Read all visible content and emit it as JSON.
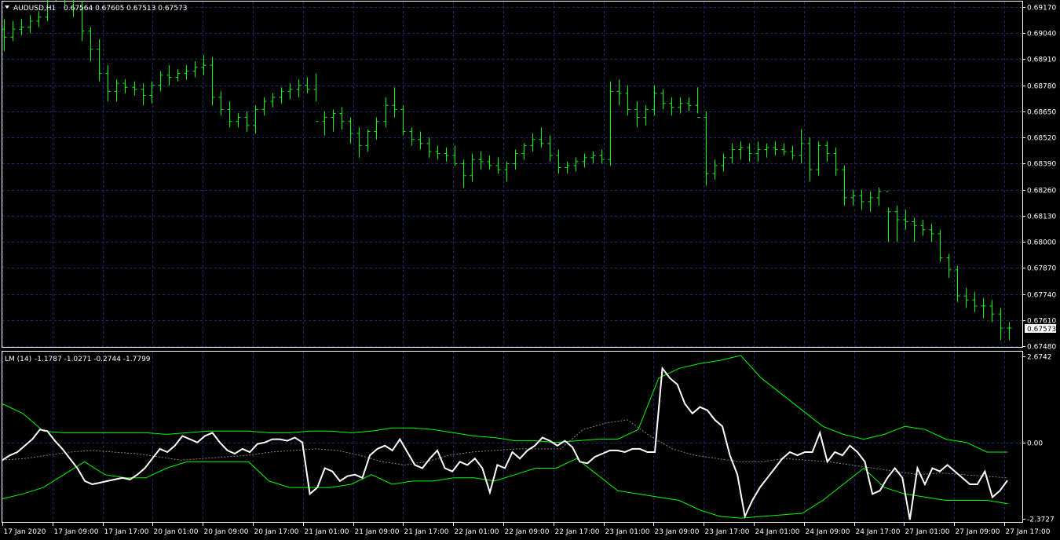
{
  "main_panel": {
    "header": {
      "symbol": "AUDUSD,H1",
      "ohlc": "0.67564 0.67605 0.67513 0.67573"
    },
    "price_axis_labels": [
      "0.69170",
      "0.69040",
      "0.68910",
      "0.68780",
      "0.68650",
      "0.68520",
      "0.68390",
      "0.68260",
      "0.68130",
      "0.68000",
      "0.67870",
      "0.67740",
      "0.67610",
      "0.67480"
    ],
    "current_price_tag": "0.67573",
    "bar_color": "#00ff00",
    "grid_color": "#1f2a6b"
  },
  "indicator_panel": {
    "header": {
      "name": "LM (14)",
      "values": "-1.1787 -1.0271 -0.2744 -1.7799"
    },
    "axis_labels": [
      "2.6742",
      "0.00",
      "-2.3727"
    ]
  },
  "time_axis_labels": [
    "17 Jan 2020",
    "17 Jan 09:00",
    "17 Jan 17:00",
    "20 Jan 01:00",
    "20 Jan 09:00",
    "20 Jan 17:00",
    "21 Jan 01:00",
    "21 Jan 09:00",
    "21 Jan 17:00",
    "22 Jan 01:00",
    "22 Jan 09:00",
    "22 Jan 17:00",
    "23 Jan 01:00",
    "23 Jan 09:00",
    "23 Jan 17:00",
    "24 Jan 01:00",
    "24 Jan 09:00",
    "24 Jan 17:00",
    "27 Jan 01:00",
    "27 Jan 09:00",
    "27 Jan 17:00"
  ],
  "chart_data": {
    "type": "line",
    "title": "AUDUSD,H1",
    "price_bars": [
      [
        0.6906,
        0.6911,
        0.6895,
        0.6902
      ],
      [
        0.6902,
        0.691,
        0.69,
        0.6906
      ],
      [
        0.6906,
        0.6911,
        0.6903,
        0.6907
      ],
      [
        0.6907,
        0.6913,
        0.6904,
        0.691
      ],
      [
        0.691,
        0.6915,
        0.6907,
        0.6912
      ],
      [
        0.6912,
        0.6928,
        0.691,
        0.6925
      ],
      [
        0.6925,
        0.6933,
        0.692,
        0.693
      ],
      [
        0.693,
        0.6933,
        0.6918,
        0.6922
      ],
      [
        0.6922,
        0.6928,
        0.6912,
        0.6916
      ],
      [
        0.6916,
        0.692,
        0.69,
        0.6905
      ],
      [
        0.6905,
        0.6907,
        0.689,
        0.6896
      ],
      [
        0.6896,
        0.6901,
        0.688,
        0.6884
      ],
      [
        0.6884,
        0.6888,
        0.687,
        0.6875
      ],
      [
        0.6875,
        0.6881,
        0.687,
        0.6879
      ],
      [
        0.6879,
        0.6881,
        0.6874,
        0.6877
      ],
      [
        0.6877,
        0.688,
        0.6873,
        0.6876
      ],
      [
        0.6876,
        0.6879,
        0.6868,
        0.6873
      ],
      [
        0.6873,
        0.688,
        0.6869,
        0.6878
      ],
      [
        0.6878,
        0.6885,
        0.6875,
        0.6883
      ],
      [
        0.6883,
        0.6888,
        0.6878,
        0.6882
      ],
      [
        0.6882,
        0.6886,
        0.688,
        0.6884
      ],
      [
        0.6884,
        0.6888,
        0.6881,
        0.6885
      ],
      [
        0.6885,
        0.689,
        0.6882,
        0.6887
      ],
      [
        0.6887,
        0.6893,
        0.6883,
        0.6888
      ],
      [
        0.6888,
        0.6892,
        0.6868,
        0.6872
      ],
      [
        0.6872,
        0.6875,
        0.6863,
        0.6866
      ],
      [
        0.6866,
        0.687,
        0.6857,
        0.686
      ],
      [
        0.686,
        0.6864,
        0.6857,
        0.6862
      ],
      [
        0.6862,
        0.6865,
        0.6855,
        0.6858
      ],
      [
        0.6858,
        0.6868,
        0.6854,
        0.6866
      ],
      [
        0.6866,
        0.6872,
        0.6863,
        0.687
      ],
      [
        0.687,
        0.6874,
        0.6867,
        0.6872
      ],
      [
        0.6872,
        0.6877,
        0.6869,
        0.6875
      ],
      [
        0.6875,
        0.6879,
        0.6871,
        0.6876
      ],
      [
        0.6876,
        0.6881,
        0.6872,
        0.6878
      ],
      [
        0.6878,
        0.6882,
        0.6874,
        0.6876
      ],
      [
        0.6876,
        0.6884,
        0.687,
        0.686
      ],
      [
        0.686,
        0.6865,
        0.6853,
        0.6862
      ],
      [
        0.6862,
        0.6866,
        0.6855,
        0.6864
      ],
      [
        0.6864,
        0.6867,
        0.6856,
        0.686
      ],
      [
        0.686,
        0.6862,
        0.6849,
        0.6854
      ],
      [
        0.6854,
        0.6857,
        0.6842,
        0.6848
      ],
      [
        0.6848,
        0.6856,
        0.6845,
        0.6855
      ],
      [
        0.6855,
        0.6862,
        0.6851,
        0.686
      ],
      [
        0.686,
        0.6872,
        0.6857,
        0.6868
      ],
      [
        0.6868,
        0.6877,
        0.6862,
        0.6866
      ],
      [
        0.6866,
        0.6868,
        0.6853,
        0.6855
      ],
      [
        0.6855,
        0.6857,
        0.6848,
        0.6851
      ],
      [
        0.6851,
        0.6855,
        0.6846,
        0.6849
      ],
      [
        0.6849,
        0.6852,
        0.6842,
        0.6845
      ],
      [
        0.6845,
        0.6848,
        0.6841,
        0.6844
      ],
      [
        0.6844,
        0.6847,
        0.684,
        0.6843
      ],
      [
        0.6843,
        0.6848,
        0.6838,
        0.6839
      ],
      [
        0.6839,
        0.6841,
        0.6827,
        0.6833
      ],
      [
        0.6833,
        0.6844,
        0.683,
        0.6841
      ],
      [
        0.6841,
        0.6845,
        0.6836,
        0.684
      ],
      [
        0.684,
        0.6843,
        0.6836,
        0.6838
      ],
      [
        0.6838,
        0.6842,
        0.6834,
        0.6836
      ],
      [
        0.6836,
        0.684,
        0.683,
        0.6839
      ],
      [
        0.6839,
        0.6846,
        0.6836,
        0.6844
      ],
      [
        0.6844,
        0.6849,
        0.6841,
        0.6848
      ],
      [
        0.6848,
        0.6854,
        0.6845,
        0.6851
      ],
      [
        0.6851,
        0.6857,
        0.6847,
        0.6849
      ],
      [
        0.6849,
        0.6853,
        0.684,
        0.6843
      ],
      [
        0.6843,
        0.6846,
        0.6834,
        0.6837
      ],
      [
        0.6837,
        0.684,
        0.6834,
        0.6838
      ],
      [
        0.6838,
        0.6842,
        0.6835,
        0.684
      ],
      [
        0.684,
        0.6844,
        0.6837,
        0.6842
      ],
      [
        0.6842,
        0.6845,
        0.6839,
        0.6843
      ],
      [
        0.6843,
        0.6846,
        0.6839,
        0.6841
      ],
      [
        0.6841,
        0.688,
        0.6838,
        0.6875
      ],
      [
        0.6875,
        0.6881,
        0.6868,
        0.6874
      ],
      [
        0.6874,
        0.6878,
        0.6863,
        0.6866
      ],
      [
        0.6866,
        0.687,
        0.6857,
        0.6862
      ],
      [
        0.6862,
        0.6868,
        0.6858,
        0.6866
      ],
      [
        0.6866,
        0.6878,
        0.6863,
        0.6874
      ],
      [
        0.6874,
        0.6876,
        0.6866,
        0.6869
      ],
      [
        0.6869,
        0.6872,
        0.6863,
        0.6867
      ],
      [
        0.6867,
        0.6872,
        0.6864,
        0.6869
      ],
      [
        0.6869,
        0.6872,
        0.6865,
        0.6868
      ],
      [
        0.6868,
        0.6877,
        0.6864,
        0.6862
      ],
      [
        0.6862,
        0.6865,
        0.6828,
        0.6834
      ],
      [
        0.6834,
        0.6841,
        0.6831,
        0.6838
      ],
      [
        0.6838,
        0.6844,
        0.6835,
        0.6842
      ],
      [
        0.6842,
        0.6849,
        0.6839,
        0.6846
      ],
      [
        0.6846,
        0.685,
        0.6841,
        0.6847
      ],
      [
        0.6847,
        0.6849,
        0.684,
        0.6844
      ],
      [
        0.6844,
        0.685,
        0.684,
        0.6846
      ],
      [
        0.6846,
        0.6849,
        0.6842,
        0.6847
      ],
      [
        0.6847,
        0.685,
        0.6843,
        0.6846
      ],
      [
        0.6846,
        0.6849,
        0.6843,
        0.6845
      ],
      [
        0.6845,
        0.6848,
        0.6841,
        0.6843
      ],
      [
        0.6843,
        0.6856,
        0.6839,
        0.6849
      ],
      [
        0.6849,
        0.6852,
        0.683,
        0.6836
      ],
      [
        0.6836,
        0.685,
        0.6833,
        0.6848
      ],
      [
        0.6848,
        0.685,
        0.684,
        0.6844
      ],
      [
        0.6844,
        0.6847,
        0.6833,
        0.6836
      ],
      [
        0.6836,
        0.6838,
        0.6818,
        0.6822
      ],
      [
        0.6822,
        0.6826,
        0.6818,
        0.6823
      ],
      [
        0.6823,
        0.6826,
        0.6816,
        0.682
      ],
      [
        0.682,
        0.6825,
        0.6815,
        0.6822
      ],
      [
        0.6822,
        0.6827,
        0.6818,
        0.6825
      ],
      [
        0.6825,
        0.6817,
        0.68,
        0.6815
      ],
      [
        0.6815,
        0.6818,
        0.68,
        0.6811
      ],
      [
        0.6811,
        0.6816,
        0.6806,
        0.681
      ],
      [
        0.681,
        0.6812,
        0.68,
        0.6808
      ],
      [
        0.6808,
        0.6811,
        0.6803,
        0.6806
      ],
      [
        0.6806,
        0.6809,
        0.68,
        0.6804
      ],
      [
        0.6804,
        0.6806,
        0.679,
        0.6792
      ],
      [
        0.6792,
        0.6794,
        0.6782,
        0.6786
      ],
      [
        0.6786,
        0.6788,
        0.677,
        0.6773
      ],
      [
        0.6773,
        0.6777,
        0.6767,
        0.6771
      ],
      [
        0.6771,
        0.6775,
        0.6765,
        0.6768
      ],
      [
        0.6768,
        0.6772,
        0.6762,
        0.6768
      ],
      [
        0.6768,
        0.6771,
        0.676,
        0.6764
      ],
      [
        0.6764,
        0.6767,
        0.6751,
        0.6757
      ],
      [
        0.6757,
        0.676,
        0.6751,
        0.6757
      ]
    ],
    "price_ylim": [
      0.6748,
      0.6917
    ],
    "indicator_series": [
      {
        "name": "LM (14)",
        "color": "#ffffff",
        "values": [
          -0.55,
          -0.4,
          -0.3,
          -0.1,
          0.1,
          0.4,
          0.35,
          0.05,
          -0.2,
          -0.5,
          -0.8,
          -1.2,
          -1.3,
          -1.25,
          -1.2,
          -1.15,
          -1.1,
          -1.15,
          -1.0,
          -0.8,
          -0.5,
          -0.2,
          -0.3,
          -0.1,
          0.2,
          0.1,
          0.0,
          0.2,
          0.3,
          0.0,
          -0.25,
          -0.35,
          -0.2,
          -0.3,
          -0.05,
          0.0,
          0.1,
          0.1,
          0.05,
          0.15,
          0.0,
          -1.6,
          -1.4,
          -0.8,
          -0.9,
          -1.2,
          -1.05,
          -1.0,
          -1.1,
          -0.4,
          -0.2,
          -0.1,
          -0.25,
          0.1,
          -0.3,
          -0.7,
          -0.8,
          -0.5,
          -0.25,
          -0.8,
          -0.9,
          -0.6,
          -0.7,
          -0.5,
          -0.8,
          -1.55,
          -0.7,
          -0.8,
          -0.3,
          -0.5,
          -0.25,
          -0.1,
          0.15,
          0.05,
          -0.1,
          0.05,
          -0.15,
          -0.6,
          -0.65,
          -0.45,
          -0.35,
          -0.25,
          -0.25,
          -0.3,
          -0.2,
          -0.2,
          -0.3,
          -0.3,
          2.3,
          2.0,
          1.8,
          1.2,
          0.9,
          1.1,
          1.0,
          0.7,
          0.5,
          -0.4,
          -1.0,
          -2.3,
          -1.8,
          -1.4,
          -1.1,
          -0.8,
          -0.5,
          -0.3,
          -0.4,
          -0.3,
          -0.3,
          0.3,
          -0.6,
          -0.3,
          -0.4,
          -0.1,
          -0.3,
          -0.6,
          -1.6,
          -1.5,
          -1.1,
          -0.8,
          -1.1,
          -2.4,
          -0.8,
          -1.3,
          -0.8,
          -0.9,
          -0.7,
          -0.9,
          -1.1,
          -1.3,
          -1.3,
          -0.9,
          -1.7,
          -1.5,
          -1.18
        ]
      },
      {
        "name": "upper band",
        "color": "#00ff00",
        "values": [
          1.2,
          0.9,
          0.35,
          0.3,
          0.3,
          0.3,
          0.3,
          0.3,
          0.25,
          0.3,
          0.35,
          0.35,
          0.35,
          0.3,
          0.3,
          0.35,
          0.35,
          0.3,
          0.35,
          0.45,
          0.45,
          0.4,
          0.3,
          0.2,
          0.15,
          0.05,
          0.05,
          0.0,
          0.05,
          0.1,
          0.1,
          0.4,
          2.0,
          2.3,
          2.45,
          2.55,
          2.7,
          2.0,
          1.5,
          1.0,
          0.5,
          0.25,
          0.1,
          0.25,
          0.5,
          0.4,
          0.1,
          0.0,
          -0.3,
          -0.3
        ]
      },
      {
        "name": "lower band",
        "color": "#00ff00",
        "values": [
          -1.75,
          -1.6,
          -1.4,
          -1.0,
          -0.6,
          -1.0,
          -1.1,
          -1.1,
          -0.8,
          -0.6,
          -0.6,
          -0.6,
          -0.6,
          -1.2,
          -1.4,
          -1.4,
          -1.4,
          -1.3,
          -1.0,
          -1.3,
          -1.2,
          -1.2,
          -1.1,
          -1.1,
          -1.2,
          -1.0,
          -0.8,
          -0.8,
          -0.5,
          -1.0,
          -1.5,
          -1.6,
          -1.7,
          -1.8,
          -2.1,
          -2.3,
          -2.35,
          -2.3,
          -2.25,
          -2.2,
          -1.8,
          -1.3,
          -0.8,
          -1.4,
          -1.6,
          -1.7,
          -1.8,
          -1.8,
          -1.8,
          -1.9
        ]
      },
      {
        "name": "signal",
        "color": "#888888",
        "values": [
          -0.55,
          -0.5,
          -0.4,
          -0.3,
          -0.25,
          -0.3,
          -0.35,
          -0.45,
          -0.55,
          -0.5,
          -0.45,
          -0.4,
          -0.3,
          -0.25,
          -0.2,
          -0.25,
          -0.4,
          -0.6,
          -0.7,
          -0.6,
          -0.4,
          -0.3,
          -0.25,
          -0.2,
          -0.2,
          -0.2,
          0.4,
          0.6,
          0.7,
          0.2,
          -0.2,
          -0.4,
          -0.5,
          -0.6,
          -0.6,
          -0.5,
          -0.55,
          -0.6,
          -0.7,
          -0.8,
          -0.9,
          -1.0,
          -0.95,
          -1.0,
          -1.05,
          -1.1
        ]
      }
    ],
    "indicator_ylim": [
      -2.3727,
      2.6742
    ]
  }
}
